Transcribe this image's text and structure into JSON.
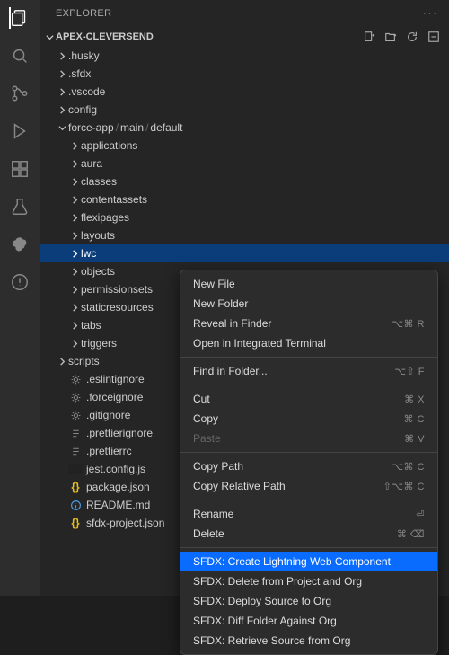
{
  "explorer_title": "EXPLORER",
  "project_name": "APEX-CLEVERSEND",
  "activity_icons": [
    "files",
    "search",
    "scm",
    "debug-run",
    "extensions",
    "testing",
    "salesforce",
    "error-history"
  ],
  "tree": [
    {
      "d": 1,
      "kind": "folder",
      "label": ".husky",
      "chev": "right"
    },
    {
      "d": 1,
      "kind": "folder",
      "label": ".sfdx",
      "chev": "right"
    },
    {
      "d": 1,
      "kind": "folder",
      "label": ".vscode",
      "chev": "right"
    },
    {
      "d": 1,
      "kind": "folder",
      "label": "config",
      "chev": "right"
    },
    {
      "d": 1,
      "kind": "breadcrumb",
      "segments": [
        "force-app",
        "main",
        "default"
      ],
      "chev": "down"
    },
    {
      "d": 2,
      "kind": "folder",
      "label": "applications",
      "chev": "right"
    },
    {
      "d": 2,
      "kind": "folder",
      "label": "aura",
      "chev": "right"
    },
    {
      "d": 2,
      "kind": "folder",
      "label": "classes",
      "chev": "right"
    },
    {
      "d": 2,
      "kind": "folder",
      "label": "contentassets",
      "chev": "right"
    },
    {
      "d": 2,
      "kind": "folder",
      "label": "flexipages",
      "chev": "right"
    },
    {
      "d": 2,
      "kind": "folder",
      "label": "layouts",
      "chev": "right"
    },
    {
      "d": 2,
      "kind": "folder",
      "label": "lwc",
      "chev": "right",
      "selected": true
    },
    {
      "d": 2,
      "kind": "folder",
      "label": "objects",
      "chev": "right"
    },
    {
      "d": 2,
      "kind": "folder",
      "label": "permissionsets",
      "chev": "right"
    },
    {
      "d": 2,
      "kind": "folder",
      "label": "staticresources",
      "chev": "right"
    },
    {
      "d": 2,
      "kind": "folder",
      "label": "tabs",
      "chev": "right"
    },
    {
      "d": 2,
      "kind": "folder",
      "label": "triggers",
      "chev": "right"
    },
    {
      "d": 1,
      "kind": "folder",
      "label": "scripts",
      "chev": "right"
    },
    {
      "d": 1,
      "kind": "file",
      "label": ".eslintignore",
      "icon": "gear",
      "color": "#888"
    },
    {
      "d": 1,
      "kind": "file",
      "label": ".forceignore",
      "icon": "gear",
      "color": "#888"
    },
    {
      "d": 1,
      "kind": "file",
      "label": ".gitignore",
      "icon": "gear",
      "color": "#888"
    },
    {
      "d": 1,
      "kind": "file",
      "label": ".prettierignore",
      "icon": "text",
      "color": "#888"
    },
    {
      "d": 1,
      "kind": "file",
      "label": ".prettierrc",
      "icon": "text",
      "color": "#888"
    },
    {
      "d": 1,
      "kind": "file",
      "label": "jest.config.js",
      "icon": "js",
      "color": "#e6c022"
    },
    {
      "d": 1,
      "kind": "file",
      "label": "package.json",
      "icon": "braces",
      "color": "#e6c022"
    },
    {
      "d": 1,
      "kind": "file",
      "label": "README.md",
      "icon": "info",
      "color": "#4a9cdf"
    },
    {
      "d": 1,
      "kind": "file",
      "label": "sfdx-project.json",
      "icon": "braces",
      "color": "#e6c022"
    }
  ],
  "context_menu": [
    {
      "label": "New File"
    },
    {
      "label": "New Folder"
    },
    {
      "label": "Reveal in Finder",
      "short": "⌥⌘ R"
    },
    {
      "label": "Open in Integrated Terminal"
    },
    {
      "sep": true
    },
    {
      "label": "Find in Folder...",
      "short": "⌥⇧ F"
    },
    {
      "sep": true
    },
    {
      "label": "Cut",
      "short": "⌘ X"
    },
    {
      "label": "Copy",
      "short": "⌘ C"
    },
    {
      "label": "Paste",
      "short": "⌘ V",
      "disabled": true
    },
    {
      "sep": true
    },
    {
      "label": "Copy Path",
      "short": "⌥⌘ C"
    },
    {
      "label": "Copy Relative Path",
      "short": "⇧⌥⌘ C"
    },
    {
      "sep": true
    },
    {
      "label": "Rename",
      "short": "⏎"
    },
    {
      "label": "Delete",
      "short": "⌘ ⌫"
    },
    {
      "sep": true
    },
    {
      "label": "SFDX: Create Lightning Web Component",
      "highlight": true
    },
    {
      "label": "SFDX: Delete from Project and Org"
    },
    {
      "label": "SFDX: Deploy Source to Org"
    },
    {
      "label": "SFDX: Diff Folder Against Org"
    },
    {
      "label": "SFDX: Retrieve Source from Org"
    }
  ],
  "header_actions": [
    "new-file",
    "new-folder",
    "refresh",
    "collapse"
  ]
}
